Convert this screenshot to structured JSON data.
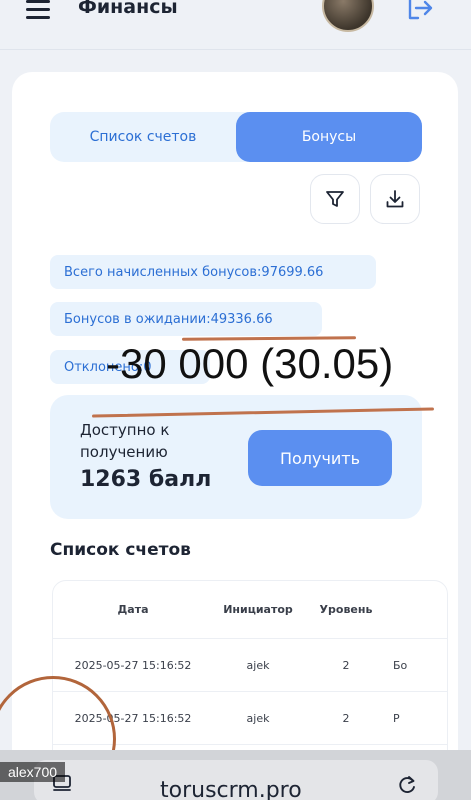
{
  "header": {
    "title": "Финансы",
    "menu_icon": "hamburger-menu-icon",
    "logout_icon": "logout-icon"
  },
  "tabs": [
    {
      "label": "Список счетов",
      "active": false
    },
    {
      "label": "Бонусы",
      "active": true
    }
  ],
  "actions": {
    "filter_icon": "filter-icon",
    "download_icon": "download-icon"
  },
  "stats": {
    "total": "Всего начисленных бонусов:97699.66",
    "pending": "Бонусов в ожидании:49336.66",
    "rejected": "Отклонено:0"
  },
  "receive": {
    "label": "Доступно к получению",
    "amount": "1263 балл",
    "button": "Получить"
  },
  "accounts": {
    "title": "Список счетов",
    "columns": [
      "Дата",
      "Инициатор",
      "Уровень",
      ""
    ],
    "rows": [
      [
        "2025-05-27 15:16:52",
        "ajek",
        "2",
        "Бо"
      ],
      [
        "2025-05-27 15:16:52",
        "ajek",
        "2",
        "Р"
      ]
    ]
  },
  "annotation": {
    "text": "-30 000 (30.05)",
    "color": "#c0724d"
  },
  "browser": {
    "url": "toruscrm.pro"
  },
  "watermark_user": "alex700",
  "colors": {
    "accent": "#5b8ff0",
    "accent_text": "#2c6fd4",
    "pill_bg": "#e9f3fd"
  }
}
